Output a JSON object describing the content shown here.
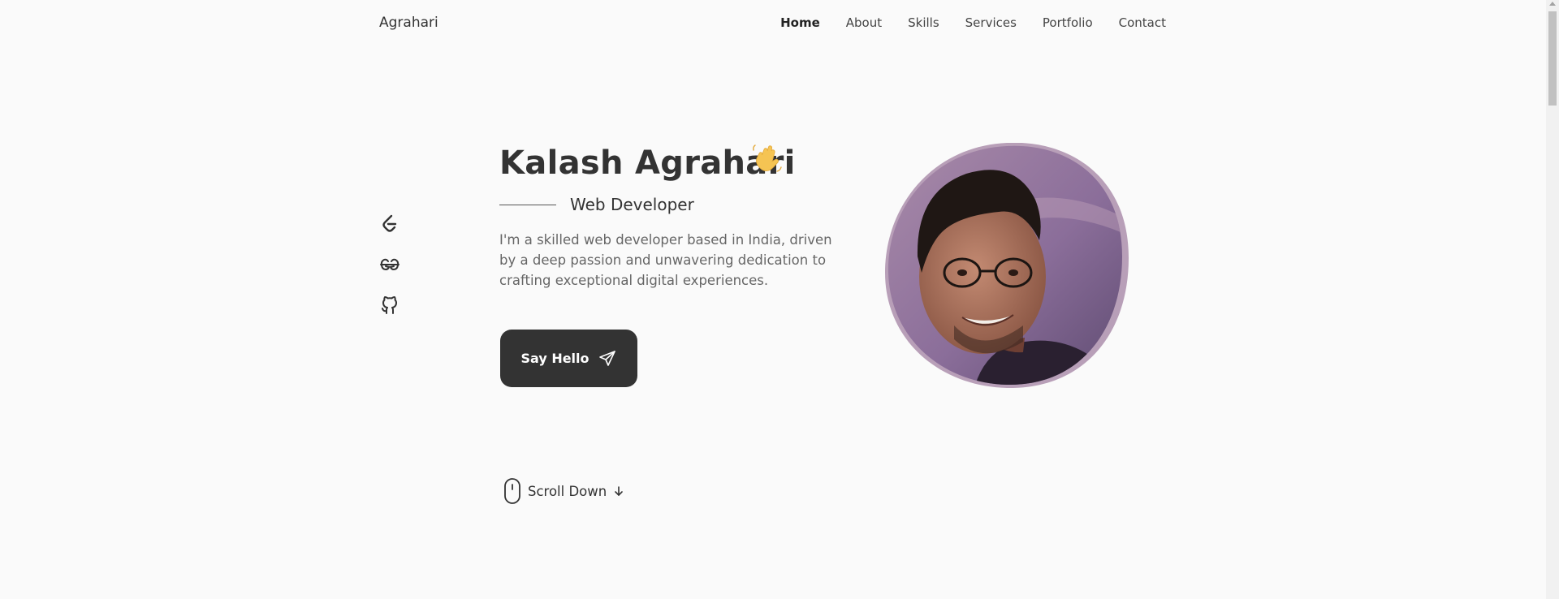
{
  "nav": {
    "logo": "Agrahari",
    "links": [
      {
        "label": "Home",
        "active": true
      },
      {
        "label": "About",
        "active": false
      },
      {
        "label": "Skills",
        "active": false
      },
      {
        "label": "Services",
        "active": false
      },
      {
        "label": "Portfolio",
        "active": false
      },
      {
        "label": "Contact",
        "active": false
      }
    ]
  },
  "socials": [
    {
      "icon": "leetcode-icon"
    },
    {
      "icon": "geeksforgeeks-icon"
    },
    {
      "icon": "github-icon"
    }
  ],
  "hero": {
    "name": "Kalash Agrahari",
    "wave_icon": "waving-hand-icon",
    "subtitle": "Web Developer",
    "description": "I'm a skilled web developer based in India, driven by a deep passion and unwavering dedication to crafting exceptional digital experiences.",
    "cta_label": "Say Hello",
    "cta_icon": "send-icon"
  },
  "scroll": {
    "label": "Scroll Down",
    "mouse_icon": "mouse-icon",
    "arrow_icon": "arrow-down-icon"
  },
  "colors": {
    "background": "#fafafa",
    "text": "#333333",
    "button": "#333333",
    "blob_border": "#b79fb6"
  }
}
